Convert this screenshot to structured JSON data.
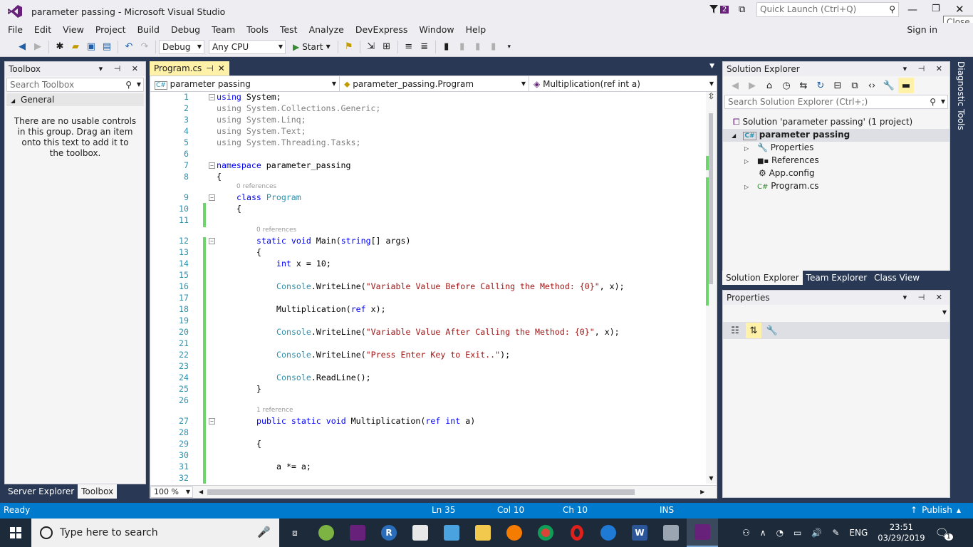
{
  "window": {
    "title": "parameter passing - Microsoft Visual Studio",
    "notification_count": "2",
    "quick_launch_placeholder": "Quick Launch (Ctrl+Q)",
    "sign_in": "Sign in",
    "close_tooltip": "Close"
  },
  "menu": [
    "File",
    "Edit",
    "View",
    "Project",
    "Build",
    "Debug",
    "Team",
    "Tools",
    "Test",
    "Analyze",
    "DevExpress",
    "Window",
    "Help"
  ],
  "toolbar": {
    "config": "Debug",
    "platform": "Any CPU",
    "start_label": "Start"
  },
  "toolbox": {
    "title": "Toolbox",
    "search_placeholder": "Search Toolbox",
    "group": "General",
    "empty_message": "There are no usable controls in this group. Drag an item onto this text to add it to the toolbox.",
    "tabs": [
      "Server Explorer",
      "Toolbox"
    ]
  },
  "editor": {
    "tab_label": "Program.cs",
    "nav_project": "parameter passing",
    "nav_class": "parameter_passing.Program",
    "nav_member": "Multiplication(ref int a)",
    "zoom": "100 %",
    "lines": [
      {
        "n": "1",
        "text": "using System;"
      },
      {
        "n": "2",
        "text": "using System.Collections.Generic;"
      },
      {
        "n": "3",
        "text": "using System.Linq;"
      },
      {
        "n": "4",
        "text": "using System.Text;"
      },
      {
        "n": "5",
        "text": "using System.Threading.Tasks;"
      },
      {
        "n": "6",
        "text": ""
      },
      {
        "n": "7",
        "text": "namespace parameter_passing"
      },
      {
        "n": "8",
        "text": "{"
      },
      {
        "n": "9",
        "text": "    class Program"
      },
      {
        "n": "10",
        "text": "    {"
      },
      {
        "n": "11",
        "text": ""
      },
      {
        "n": "12",
        "text": "        static void Main(string[] args)"
      },
      {
        "n": "13",
        "text": "        {"
      },
      {
        "n": "14",
        "text": "            int x = 10;"
      },
      {
        "n": "15",
        "text": ""
      },
      {
        "n": "16",
        "text": "            Console.WriteLine(\"Variable Value Before Calling the Method: {0}\", x);"
      },
      {
        "n": "17",
        "text": ""
      },
      {
        "n": "18",
        "text": "            Multiplication(ref x);"
      },
      {
        "n": "19",
        "text": ""
      },
      {
        "n": "20",
        "text": "            Console.WriteLine(\"Variable Value After Calling the Method: {0}\", x);"
      },
      {
        "n": "21",
        "text": ""
      },
      {
        "n": "22",
        "text": "            Console.WriteLine(\"Press Enter Key to Exit..\");"
      },
      {
        "n": "23",
        "text": ""
      },
      {
        "n": "24",
        "text": "            Console.ReadLine();"
      },
      {
        "n": "25",
        "text": "        }"
      },
      {
        "n": "26",
        "text": ""
      },
      {
        "n": "27",
        "text": "        public static void Multiplication(ref int a)"
      },
      {
        "n": "28",
        "text": ""
      },
      {
        "n": "29",
        "text": "        {"
      },
      {
        "n": "30",
        "text": ""
      },
      {
        "n": "31",
        "text": "            a *= a;"
      },
      {
        "n": "32",
        "text": ""
      }
    ],
    "refs": {
      "class": "0 references",
      "main": "0 references",
      "mult": "1 reference"
    }
  },
  "solution_explorer": {
    "title": "Solution Explorer",
    "search_placeholder": "Search Solution Explorer (Ctrl+;)",
    "solution": "Solution 'parameter passing' (1 project)",
    "project": "parameter passing",
    "items": [
      "Properties",
      "References",
      "App.config",
      "Program.cs"
    ],
    "tabs": [
      "Solution Explorer",
      "Team Explorer",
      "Class View"
    ]
  },
  "properties": {
    "title": "Properties"
  },
  "diagnostic_tools": "Diagnostic Tools",
  "status": {
    "ready": "Ready",
    "ln": "Ln 35",
    "col": "Col 10",
    "ch": "Ch 10",
    "ins": "INS",
    "publish": "Publish"
  },
  "taskbar": {
    "search": "Type here to search",
    "lang": "ENG",
    "time": "23:51",
    "date": "03/29/2019",
    "notif": "1"
  },
  "colors": {
    "accent": "#007acc",
    "vs_purple": "#68217a",
    "tab_active": "#fff1a8",
    "line_numbers": "#2b91af",
    "keyword": "#0000ff",
    "type": "#2b91af",
    "string": "#a31515"
  }
}
